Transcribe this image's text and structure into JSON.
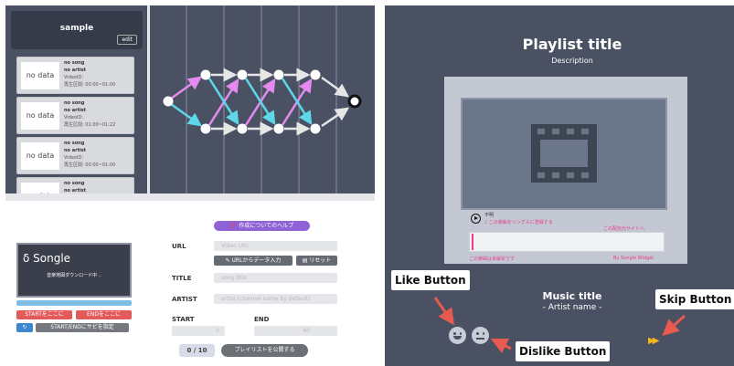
{
  "editor": {
    "playlist": {
      "title": "sample",
      "edit_label": "edit"
    },
    "songs": [
      {
        "thumb": "no data",
        "title": "no song",
        "artist": "no artist",
        "video": "VideoID:",
        "range": "再生区間: 00:00~01:00"
      },
      {
        "thumb": "no data",
        "title": "no song",
        "artist": "no artist",
        "video": "VideoID:",
        "range": "再生区間: 01:00~01:22"
      },
      {
        "thumb": "no data",
        "title": "no song",
        "artist": "no artist",
        "video": "VideoID:",
        "range": "再生区間: 00:00~01:00"
      },
      {
        "thumb": "no data",
        "title": "no song",
        "artist": "no artist",
        "video": "",
        "range": ""
      }
    ],
    "form": {
      "help_label": "作成についてのヘルプ",
      "preview_logo": "Songle",
      "preview_loading": "音楽地図ダウンロード中 ..",
      "start_here": "STARTをここに",
      "end_here": "ENDをここに",
      "repeat_icon": "repeat-icon",
      "sabi_label": "START/ENDにサビを指定",
      "url_label": "URL",
      "url_placeholder": "Video URL",
      "url_fill_label": "URLからデータ入力",
      "reset_label": "リセット",
      "title_label": "TITLE",
      "title_placeholder": "song title",
      "artist_label": "ARTIST",
      "artist_placeholder": "artist (channel name by default)",
      "start_label": "START",
      "end_label": "END",
      "start_value": "0",
      "end_value": "60",
      "count": "0 / 10",
      "publish_label": "プレイリストを公開する"
    },
    "colors": {
      "forward": "#e58af0",
      "backward": "#5ed8e8",
      "accent": "#8f62d6"
    }
  },
  "player": {
    "playlist_title": "Playlist title",
    "description": "Description",
    "status_unknown": "不明",
    "register_link": "♪ この楽曲をソングルに登録する",
    "source_link": "この配信元サイトへ",
    "not_analyzed": "この楽曲は未解析です",
    "by_widget": "By Songle Widget",
    "music_title": "Music title",
    "artist_name": "- Artist name -",
    "callouts": {
      "like": "Like Button",
      "dislike": "Dislike Button",
      "skip": "Skip Button"
    },
    "skip_icon": "fast-forward-icon",
    "colors": {
      "callout_arrow": "#e85a4f",
      "skip": "#f0b81a",
      "link": "#ea3c8f"
    }
  }
}
